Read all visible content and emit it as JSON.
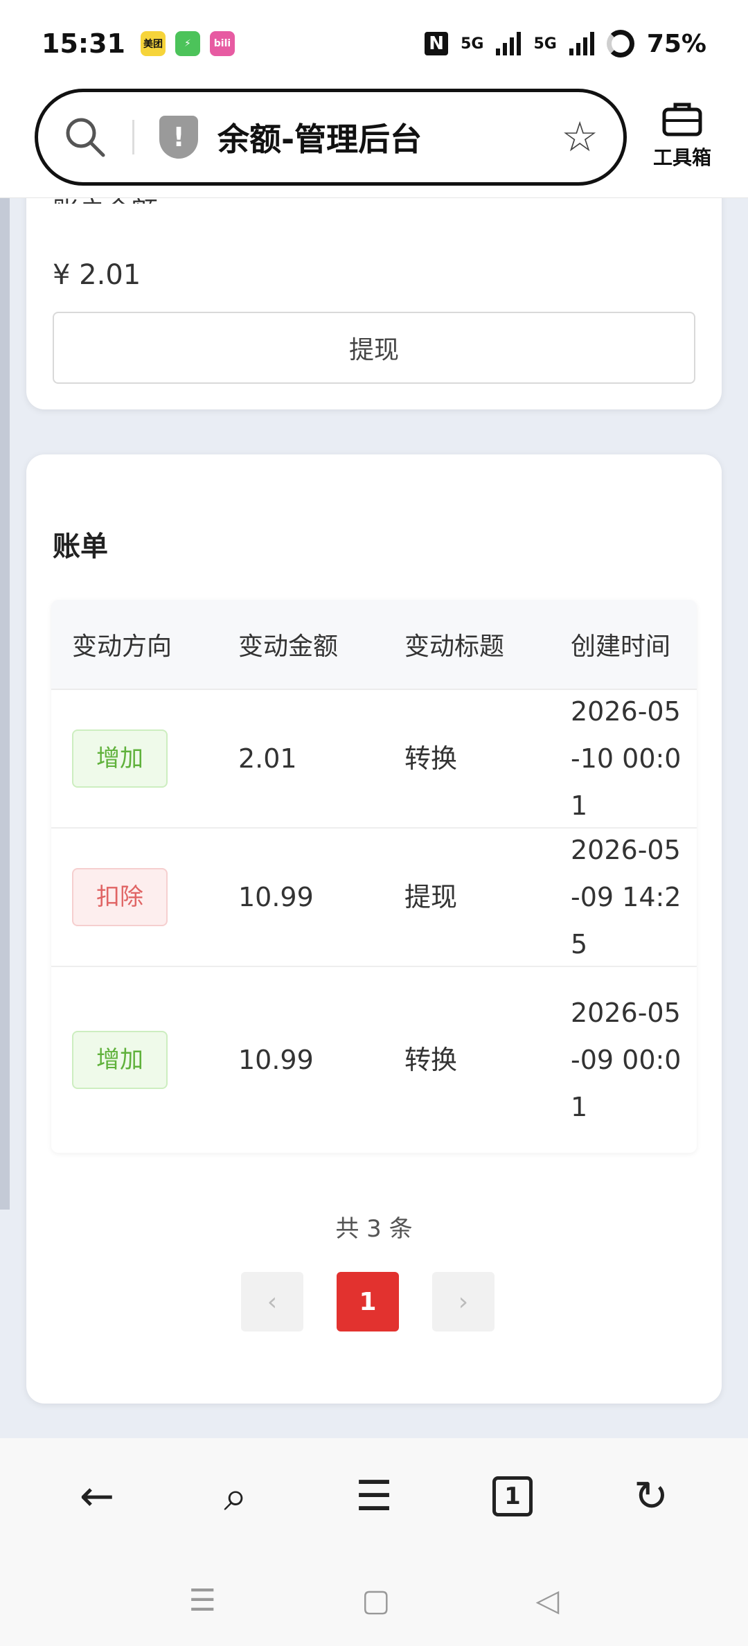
{
  "status_bar": {
    "time": "15:31",
    "apps": [
      "美团",
      "⚡",
      "bili"
    ],
    "network1": "5G",
    "network2": "5G",
    "battery": "75%"
  },
  "browser": {
    "page_title": "余额-管理后台",
    "toolbox_label": "工具箱"
  },
  "balance_card": {
    "partial_label": "账户余额",
    "balance": "¥ 2.01",
    "withdraw_label": "提现"
  },
  "bill_card": {
    "title": "账单",
    "columns": [
      "变动方向",
      "变动金额",
      "变动标题",
      "创建时间"
    ],
    "rows": [
      {
        "direction": "增加",
        "type": "add",
        "amount": "2.01",
        "title": "转换",
        "time": "2026-05\n-10 00:01"
      },
      {
        "direction": "扣除",
        "type": "sub",
        "amount": "10.99",
        "title": "提现",
        "time": "2026-05\n-09 14:25"
      },
      {
        "direction": "增加",
        "type": "add",
        "amount": "10.99",
        "title": "转换",
        "time": "2026-05\n-09 00:0\n1"
      }
    ],
    "total": "共 3 条",
    "pagination": {
      "prev": "‹",
      "current": "1",
      "next": "›"
    }
  },
  "bottom_bar": {
    "back": "←",
    "search": "⌕",
    "menu": "☰",
    "tabs_count": "1",
    "refresh": "↻"
  },
  "system_nav": {
    "menu": "☰",
    "home": "▢",
    "back": "◁"
  },
  "colors": {
    "accent": "#e2322f",
    "add_tag": "#5fb13b",
    "sub_tag": "#e06464"
  }
}
